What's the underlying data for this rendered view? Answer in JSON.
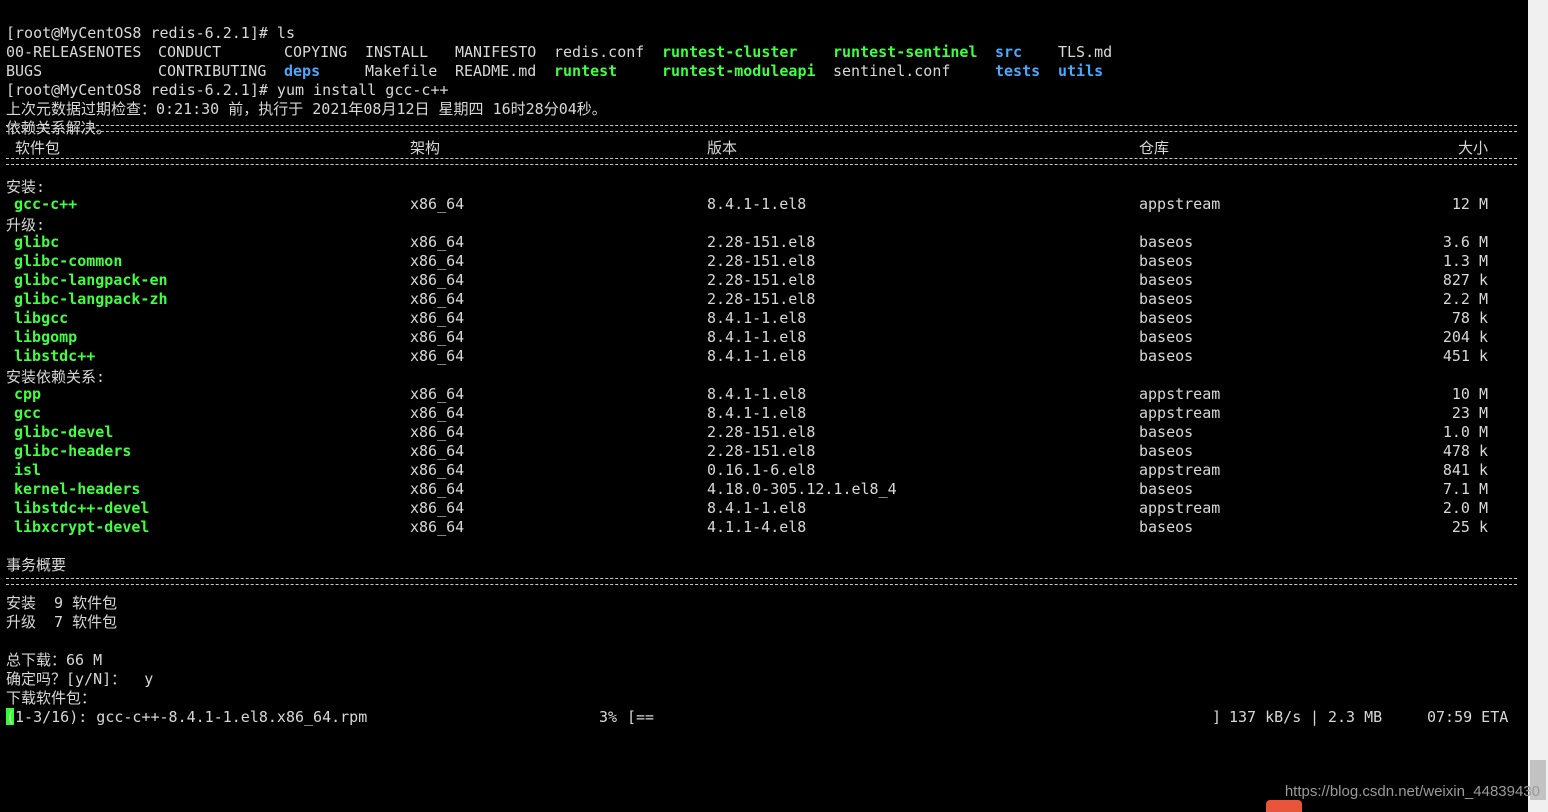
{
  "prompt1": "[root@MyCentOS8 redis-6.2.1]# ls",
  "ls_row1": [
    "00-RELEASENOTES",
    "CONDUCT",
    "COPYING",
    "INSTALL",
    "MANIFESTO",
    "redis.conf",
    "runtest-cluster",
    "runtest-sentinel",
    "src",
    "TLS.md"
  ],
  "ls_row2": [
    "BUGS",
    "CONTRIBUTING",
    "deps",
    "Makefile",
    "README.md",
    "runtest",
    "runtest-moduleapi",
    "sentinel.conf",
    "tests",
    "utils"
  ],
  "prompt2": "[root@MyCentOS8 redis-6.2.1]# yum install gcc-c++",
  "meta_line": "上次元数据过期检查：0:21:30 前，执行于 2021年08月12日 星期四 16时28分04秒。",
  "deps_resolved": "依赖关系解决。",
  "headers": {
    "package": "软件包",
    "arch": "架构",
    "version": "版本",
    "repo": "仓库",
    "size": "大小"
  },
  "sections": [
    {
      "title": "安装:",
      "rows": [
        {
          "name": "gcc-c++",
          "arch": "x86_64",
          "version": "8.4.1-1.el8",
          "repo": "appstream",
          "size": "12 M"
        }
      ]
    },
    {
      "title": "升级:",
      "rows": [
        {
          "name": "glibc",
          "arch": "x86_64",
          "version": "2.28-151.el8",
          "repo": "baseos",
          "size": "3.6 M"
        },
        {
          "name": "glibc-common",
          "arch": "x86_64",
          "version": "2.28-151.el8",
          "repo": "baseos",
          "size": "1.3 M"
        },
        {
          "name": "glibc-langpack-en",
          "arch": "x86_64",
          "version": "2.28-151.el8",
          "repo": "baseos",
          "size": "827 k"
        },
        {
          "name": "glibc-langpack-zh",
          "arch": "x86_64",
          "version": "2.28-151.el8",
          "repo": "baseos",
          "size": "2.2 M"
        },
        {
          "name": "libgcc",
          "arch": "x86_64",
          "version": "8.4.1-1.el8",
          "repo": "baseos",
          "size": "78 k"
        },
        {
          "name": "libgomp",
          "arch": "x86_64",
          "version": "8.4.1-1.el8",
          "repo": "baseos",
          "size": "204 k"
        },
        {
          "name": "libstdc++",
          "arch": "x86_64",
          "version": "8.4.1-1.el8",
          "repo": "baseos",
          "size": "451 k"
        }
      ]
    },
    {
      "title": "安装依赖关系:",
      "rows": [
        {
          "name": "cpp",
          "arch": "x86_64",
          "version": "8.4.1-1.el8",
          "repo": "appstream",
          "size": "10 M"
        },
        {
          "name": "gcc",
          "arch": "x86_64",
          "version": "8.4.1-1.el8",
          "repo": "appstream",
          "size": "23 M"
        },
        {
          "name": "glibc-devel",
          "arch": "x86_64",
          "version": "2.28-151.el8",
          "repo": "baseos",
          "size": "1.0 M"
        },
        {
          "name": "glibc-headers",
          "arch": "x86_64",
          "version": "2.28-151.el8",
          "repo": "baseos",
          "size": "478 k"
        },
        {
          "name": "isl",
          "arch": "x86_64",
          "version": "0.16.1-6.el8",
          "repo": "appstream",
          "size": "841 k"
        },
        {
          "name": "kernel-headers",
          "arch": "x86_64",
          "version": "4.18.0-305.12.1.el8_4",
          "repo": "baseos",
          "size": "7.1 M"
        },
        {
          "name": "libstdc++-devel",
          "arch": "x86_64",
          "version": "8.4.1-1.el8",
          "repo": "appstream",
          "size": "2.0 M"
        },
        {
          "name": "libxcrypt-devel",
          "arch": "x86_64",
          "version": "4.1.1-4.el8",
          "repo": "baseos",
          "size": "25 k"
        }
      ]
    }
  ],
  "summary_title": "事务概要",
  "summary_install": "安装  9 软件包",
  "summary_upgrade": "升级  7 软件包",
  "total_download": "总下载：66 M",
  "confirm": "确定吗？[y/N]：  y",
  "downloading": "下载软件包：",
  "progress": {
    "file": "(1-3/16): gcc-c++-8.4.1-1.el8.x86_64.rpm",
    "percent": "3%",
    "bar": "[==",
    "bar_end": "]",
    "speed": "137 kB/s",
    "sep": "|",
    "downloaded": "2.3 MB",
    "eta": "07:59 ETA"
  },
  "watermark": "https://blog.csdn.net/weixin_44839430",
  "colors": {
    "background": "#000000",
    "text": "#d8d8d8",
    "exec": "#40ff40",
    "dir": "#4aa8ff"
  }
}
